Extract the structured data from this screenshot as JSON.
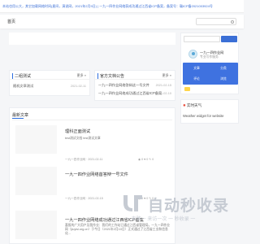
{
  "topbar": {
    "text": "本站也用公大，其它加载网络时间(星间，演说网，2021年2月9日) | 一九一四作业网络获成功通过江西省ICP备案，备案号：赣ICP备2021003924号"
  },
  "navbar": {
    "home_label": "首页"
  },
  "notice_card": {
    "title": "二组测试",
    "more_label": "更多 »",
    "items": [
      {
        "title": "随机文章测试",
        "date": "2021-02-11"
      }
    ]
  },
  "announce_card": {
    "title": "官方文档公告",
    "more_label": "更多 »",
    "items": [
      {
        "title": "一九一四作业网络答辩这一号文件",
        "date": "2021-02-15"
      },
      {
        "title": "一九一四作业网络成功通过江西省ICP备案",
        "date": "2021-02-10"
      }
    ]
  },
  "profile": {
    "name": "一九一四作业网",
    "subtitle": "专业写作服务",
    "stats": [
      {
        "label": "文章"
      },
      {
        "label": "分类"
      },
      {
        "label": "评论"
      },
      {
        "label": "浏览"
      }
    ]
  },
  "weather": {
    "title": "实时天气",
    "text": "Weather widget for website"
  },
  "articles": {
    "heading": "最新文章",
    "items": [
      {
        "title": "理科正面测试",
        "desc": "test测试文档 test测试文章",
        "meta": "一九一四作业网  ·  2021-02-11",
        "stats": "◉ 0  ♥ 0  ✎ 0"
      },
      {
        "title": "一九一四作业网络首答辩一号文件",
        "desc": "",
        "meta": "一九一四作业网  ·  2021-02-15",
        "stats": "◉ 0  ♥ 0  ✎ 0"
      },
      {
        "title": "一九一四作业网络成功通过江西省ICP备案",
        "desc": "喜报的广大用户及我作业：我们的工作站已通过江西省管理局，一九一四作业网（jiuyisi.org.cn）于今日（2021年2月10日）正式通过了江西省工业和信息化...",
        "meta": "",
        "stats": ""
      }
    ]
  },
  "watermark": {
    "text": "自动秒收录",
    "sub": "一 来路一 来访一次 一 秒收录 一"
  },
  "colors": {
    "accent": "#3b6fd6",
    "stats_bg": "#3f72e0",
    "watermark": "#c6cbd3"
  }
}
